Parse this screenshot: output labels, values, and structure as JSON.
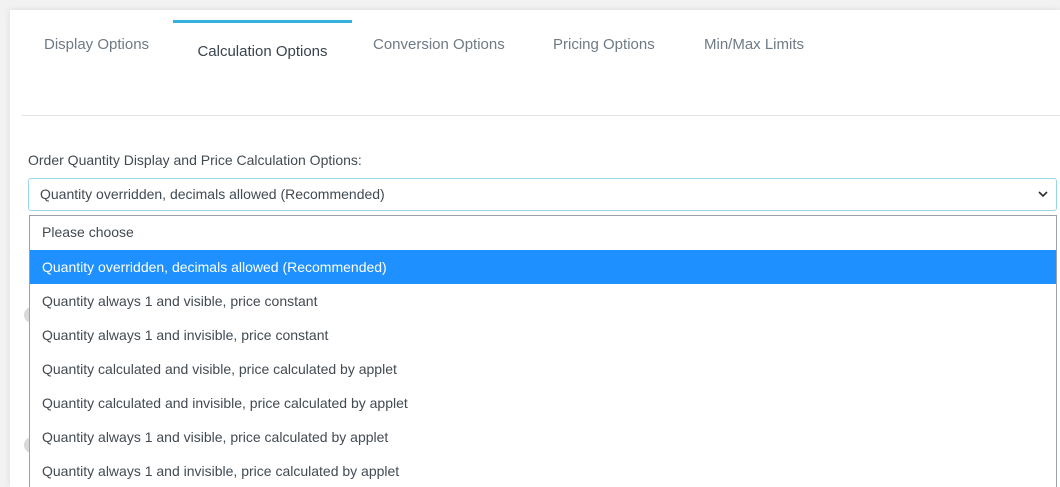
{
  "tabs": [
    {
      "label": "Display Options",
      "active": false
    },
    {
      "label": "Calculation Options",
      "active": true
    },
    {
      "label": "Conversion Options",
      "active": false
    },
    {
      "label": "Pricing Options",
      "active": false
    },
    {
      "label": "Min/Max Limits",
      "active": false
    }
  ],
  "field": {
    "label": "Order Quantity Display and Price Calculation Options:",
    "selected_value": "Quantity overridden, decimals allowed (Recommended)"
  },
  "options": [
    "Please choose",
    "Quantity overridden, decimals allowed (Recommended)",
    "Quantity always 1 and visible, price constant",
    "Quantity always 1 and invisible, price constant",
    "Quantity calculated and visible, price calculated by applet",
    "Quantity calculated and invisible, price calculated by applet",
    "Quantity always 1 and visible, price calculated by applet",
    "Quantity always 1 and invisible, price calculated by applet"
  ],
  "selected_index": 1,
  "colors": {
    "accent": "#33b3dc",
    "highlight": "#1e90ff",
    "text": "#424a52",
    "tab_text": "#6e7a85"
  },
  "icons": {
    "select_toggle": "chevron-down-icon"
  }
}
